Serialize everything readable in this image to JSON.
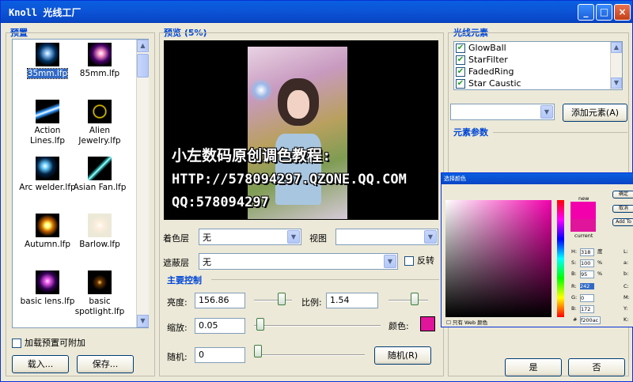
{
  "window": {
    "title": "Knoll 光线工厂",
    "min": "_",
    "max": "□",
    "close": "×"
  },
  "presets": {
    "header": "预置",
    "items": [
      {
        "label": "35mm.lfp",
        "selected": true,
        "icon": "lens-flare-blue-icon"
      },
      {
        "label": "85mm.lfp",
        "selected": false,
        "icon": "lens-flare-pink-icon"
      },
      {
        "label": "Action Lines.lfp",
        "selected": false,
        "icon": "action-lines-icon"
      },
      {
        "label": "Alien Jewelry.lfp",
        "selected": false,
        "icon": "alien-jewelry-icon"
      },
      {
        "label": "Arc welder.lfp",
        "selected": false,
        "icon": "arc-welder-icon"
      },
      {
        "label": "Asian Fan.lfp",
        "selected": false,
        "icon": "asian-fan-icon"
      },
      {
        "label": "Autumn.lfp",
        "selected": false,
        "icon": "autumn-icon"
      },
      {
        "label": "Barlow.lfp",
        "selected": false,
        "icon": "barlow-icon"
      },
      {
        "label": "basic lens.lfp",
        "selected": false,
        "icon": "basic-lens-icon"
      },
      {
        "label": "basic spotlight.lfp",
        "selected": false,
        "icon": "basic-spotlight-icon"
      }
    ],
    "additive_label": "加载预置可附加",
    "additive_checked": false,
    "load_button": "载入...",
    "save_button": "保存..."
  },
  "preview": {
    "header": "预览 (5%)",
    "overlay_line1": "小左数码原创调色教程:",
    "overlay_line2": "HTTP://578094297.QZONE.QQ.COM",
    "overlay_line3": "QQ:578094297"
  },
  "layers": {
    "color_label": "着色层",
    "color_value": "无",
    "view_label": "视图",
    "view_value": "",
    "mask_label": "遮蔽层",
    "mask_value": "无",
    "invert_label": "反转",
    "invert_checked": false
  },
  "controls": {
    "header": "主要控制",
    "brightness_label": "亮度:",
    "brightness_value": "156.86",
    "brightness_slider": 0.8,
    "scale_label": "比例:",
    "scale_value": "1.54",
    "scale_slider": 0.7,
    "zoom_label": "缩放:",
    "zoom_value": "0.05",
    "zoom_slider": 0.02,
    "color_label": "颜色:",
    "color_swatch": "#e0159b",
    "random_label": "随机:",
    "random_value": "0",
    "random_slider": 0.0,
    "random_button": "随机(R)"
  },
  "elements": {
    "header": "光线元素",
    "items": [
      {
        "label": "GlowBall",
        "checked": true
      },
      {
        "label": "StarFilter",
        "checked": true
      },
      {
        "label": "FadedRing",
        "checked": true
      },
      {
        "label": "Star Caustic",
        "checked": true
      }
    ],
    "add_button": "添加元素(A)",
    "params_header": "元素参数"
  },
  "footer": {
    "ok_button": "是",
    "cancel_button": "否"
  },
  "color_picker": {
    "title": "选择颜色",
    "new_label": "new",
    "current_label": "current",
    "ok": "确定",
    "cancel": "取消",
    "add": "Add To",
    "h_label": "H:",
    "h_value": "318",
    "h_unit": "度",
    "s_label": "S:",
    "s_value": "100",
    "s_unit": "%",
    "b_label": "B:",
    "b_value": "95",
    "b_unit": "%",
    "r_label": "R:",
    "r_value": "242",
    "g_label": "G:",
    "g_value": "0",
    "bb_label": "B:",
    "bb_value": "172",
    "hex_label": "#",
    "hex_value": "f200ac",
    "web_only": "只有 Web 颜色",
    "L": "L:",
    "a": "a:",
    "b2": "b:",
    "C": "C:",
    "M": "M:",
    "Y": "Y:",
    "K": "K:",
    "new_color": "#f200ac"
  }
}
